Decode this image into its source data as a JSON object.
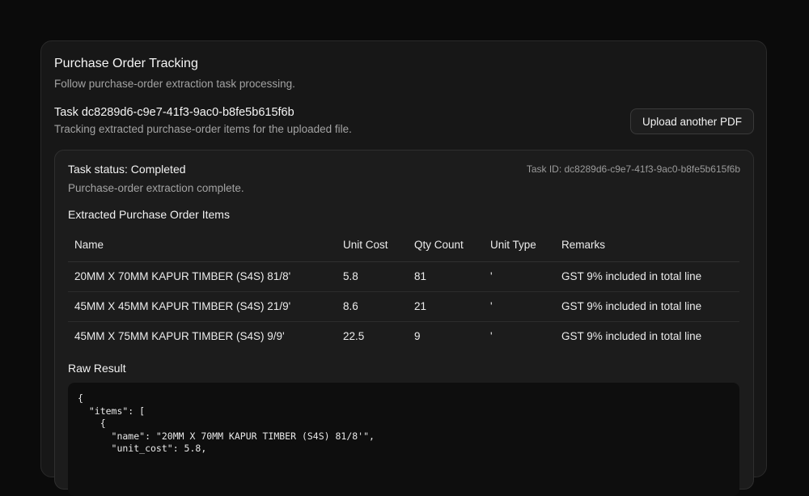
{
  "header": {
    "title": "Purchase Order Tracking",
    "subtitle": "Follow purchase-order extraction task processing."
  },
  "task": {
    "title": "Task dc8289d6-c9e7-41f3-9ac0-b8fe5b615f6b",
    "description": "Tracking extracted purchase-order items for the uploaded file.",
    "upload_label": "Upload another PDF"
  },
  "status": {
    "title": "Task status: Completed",
    "task_id": "Task ID: dc8289d6-c9e7-41f3-9ac0-b8fe5b615f6b",
    "message": "Purchase-order extraction complete."
  },
  "items_table": {
    "heading": "Extracted Purchase Order Items",
    "columns": [
      "Name",
      "Unit Cost",
      "Qty Count",
      "Unit Type",
      "Remarks"
    ],
    "rows": [
      [
        "20MM X 70MM KAPUR TIMBER (S4S) 81/8'",
        "5.8",
        "81",
        "'",
        "GST 9% included in total line"
      ],
      [
        "45MM X 45MM KAPUR TIMBER (S4S) 21/9'",
        "8.6",
        "21",
        "'",
        "GST 9% included in total line"
      ],
      [
        "45MM X 75MM KAPUR TIMBER (S4S) 9/9'",
        "22.5",
        "9",
        "'",
        "GST 9% included in total line"
      ]
    ]
  },
  "raw": {
    "heading": "Raw Result",
    "content": "{\n  \"items\": [\n    {\n      \"name\": \"20MM X 70MM KAPUR TIMBER (S4S) 81/8'\",\n      \"unit_cost\": 5.8,"
  }
}
